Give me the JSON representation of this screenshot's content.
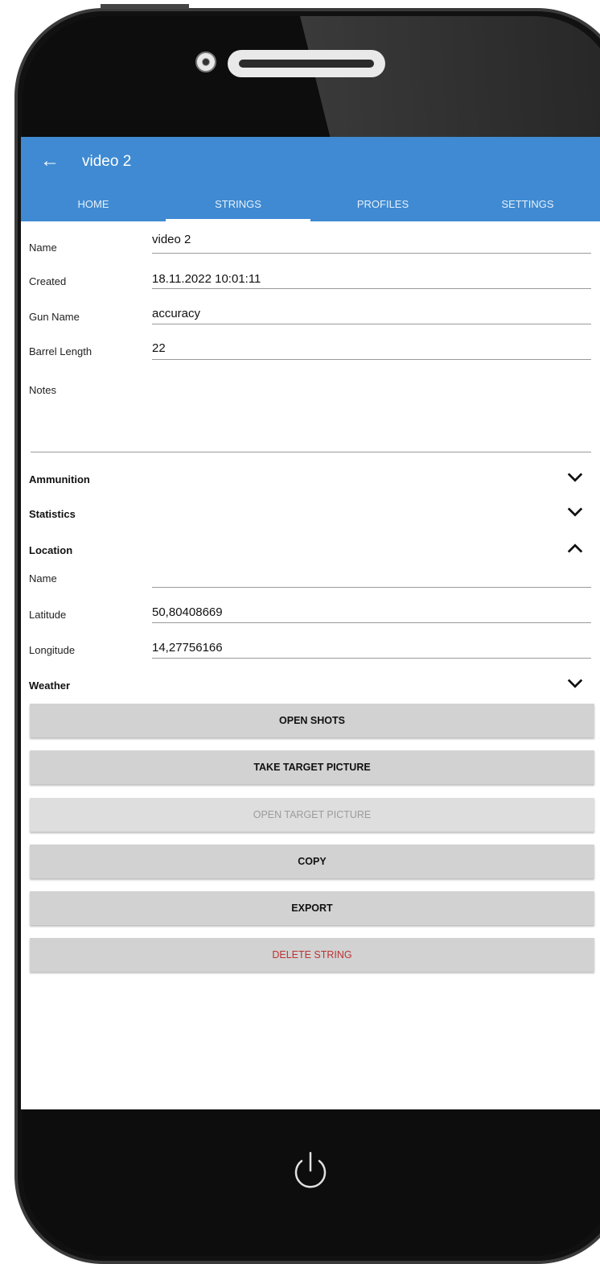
{
  "appbar": {
    "title": "video 2"
  },
  "tabs": [
    {
      "label": "HOME"
    },
    {
      "label": "STRINGS"
    },
    {
      "label": "PROFILES"
    },
    {
      "label": "SETTINGS"
    }
  ],
  "active_tab": "STRINGS",
  "form": {
    "name_label": "Name",
    "name_value": "video 2",
    "created_label": "Created",
    "created_value": "18.11.2022 10:01:11",
    "gun_label": "Gun Name",
    "gun_value": "accuracy",
    "barrel_label": "Barrel Length",
    "barrel_value": "22",
    "notes_label": "Notes",
    "notes_value": ""
  },
  "sections": {
    "ammunition": "Ammunition",
    "statistics": "Statistics",
    "location": "Location",
    "weather": "Weather"
  },
  "location": {
    "name_label": "Name",
    "name_value": "",
    "lat_label": "Latitude",
    "lat_value": "50,80408669",
    "lon_label": "Longitude",
    "lon_value": "14,27756166"
  },
  "buttons": {
    "open_shots": "OPEN SHOTS",
    "take_picture": "TAKE TARGET PICTURE",
    "open_picture": "OPEN TARGET PICTURE",
    "copy": "COPY",
    "export": "EXPORT",
    "delete": "DELETE STRING"
  },
  "colors": {
    "appbar": "#3f8ad2",
    "delete_text": "#b33333",
    "button": "#d2d2d2"
  },
  "icons": {
    "back": "arrow-left-icon",
    "expand": "chevron-down-icon",
    "collapse": "chevron-up-icon",
    "power": "power-icon"
  }
}
